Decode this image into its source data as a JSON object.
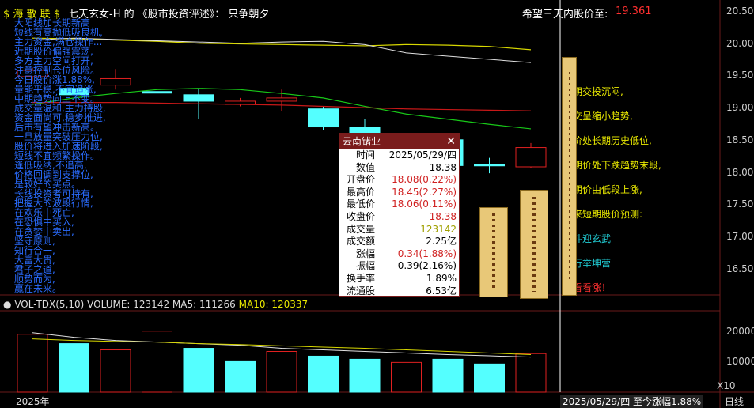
{
  "header": {
    "tag": "$ 海 散 联 $",
    "sep": "七天玄女-H  的 《股市投资评述》： 只争朝夕",
    "target_label": "希望三天内股价至:",
    "target_value": "19.361"
  },
  "axis_right": [
    "20.50",
    "20.00",
    "19.50",
    "19.00",
    "18.50",
    "18.00",
    "17.50",
    "17.00",
    "16.50"
  ],
  "vol_axis": [
    "20000",
    "10000"
  ],
  "vol_header": {
    "name": "VOL-TDX(5,10)",
    "volume": "VOLUME: 123142",
    "ma5": "MA5: 111266",
    "ma10": "MA10: 120337"
  },
  "footer": {
    "year": "2025年",
    "date_change": "2025/05/29/四  至今涨幅1.88%",
    "scale": "X10",
    "period": "日线"
  },
  "popup": {
    "title": "云南锗业",
    "rows": [
      {
        "label": "时间",
        "value": "2025/05/29/四",
        "color": "#000"
      },
      {
        "label": "数值",
        "value": "18.38",
        "color": "#000"
      },
      {
        "label": "开盘价",
        "value": "18.08(0.22%)",
        "color": "#d02020"
      },
      {
        "label": "最高价",
        "value": "18.45(2.27%)",
        "color": "#d02020"
      },
      {
        "label": "最低价",
        "value": "18.06(0.11%)",
        "color": "#d02020"
      },
      {
        "label": "收盘价",
        "value": "18.38",
        "color": "#d02020"
      },
      {
        "label": "成交量",
        "value": "123142",
        "color": "#a0a000"
      },
      {
        "label": "成交额",
        "value": "2.25亿",
        "color": "#000"
      },
      {
        "label": "涨幅",
        "value": "0.34(1.88%)",
        "color": "#d02020"
      },
      {
        "label": "振幅",
        "value": "0.39(2.16%)",
        "color": "#000"
      },
      {
        "label": "换手率",
        "value": "1.89%",
        "color": "#000"
      },
      {
        "label": "流通股",
        "value": "6.53亿",
        "color": "#000"
      }
    ]
  },
  "left_text": [
    "大阳线加长期新高",
    "短线有高抛低吸良机,",
    "主力资金,满仓操作...",
    "近期股价偏强震荡,",
    "多方主力空间打开,",
    "注意控制仓位风险。",
    "今日股价涨1.88%,",
    "量能平稳,不宜追涨,",
    "中期趋势向上不变。",
    "成交量温和,主力持股,",
    "资金面尚可,稳步推进,",
    "后市有望冲击新高。",
    "一旦放量突破压力位,",
    "股价将进入加速阶段,",
    "短线不宜频繁操作。",
    "逢低吸纳,不追高,",
    "价格回调到支撑位,",
    "是较好的买点。",
    "长线投资者可持有,",
    "把握大的波段行情,",
    "在欢乐中死亡,",
    "在恐惧中买入,",
    "在贪婪中卖出,",
    "坚守原则,",
    "知行合一,",
    "大富大贵,",
    "君子之道,",
    "顺势而为,",
    "赢在未来。"
  ],
  "right_text": [
    {
      "t": "近期交投沉闷,",
      "c": "#e8e800"
    },
    {
      "t": "成交呈缩小趋势,",
      "c": "#e8e800"
    },
    {
      "t": "现价处长期历史低位,",
      "c": "#e8e800"
    },
    {
      "t": "中期价处下跌趋势末段,",
      "c": "#e8e800"
    },
    {
      "t": "短期价由低段上涨,",
      "c": "#e8e800"
    },
    {
      "t": "未来短期股价预测:",
      "c": "#e8e800"
    },
    {
      "t": "北斗迎玄武",
      "c": "#20c8d0"
    },
    {
      "t": "五行举坤营",
      "c": "#20c8d0"
    },
    {
      "t": "要看看涨！",
      "c": "#ff3030"
    }
  ],
  "chart_data": {
    "type": "candlestick",
    "ylim": [
      16.2,
      20.6
    ],
    "candles": [
      {
        "o": 19.48,
        "c": 19.58,
        "h": 19.62,
        "l": 19.4,
        "up": true
      },
      {
        "o": 19.2,
        "c": 19.3,
        "h": 19.5,
        "l": 19.05,
        "up": false
      },
      {
        "o": 19.35,
        "c": 19.45,
        "h": 19.6,
        "l": 19.28,
        "up": true
      },
      {
        "o": 19.25,
        "c": 19.23,
        "h": 19.65,
        "l": 18.98,
        "up": false
      },
      {
        "o": 19.2,
        "c": 19.1,
        "h": 19.3,
        "l": 18.82,
        "up": false
      },
      {
        "o": 19.05,
        "c": 19.1,
        "h": 19.15,
        "l": 19.02,
        "up": true
      },
      {
        "o": 19.1,
        "c": 19.15,
        "h": 19.28,
        "l": 18.95,
        "up": true
      },
      {
        "o": 18.98,
        "c": 18.7,
        "h": 19.02,
        "l": 18.65,
        "up": false
      },
      {
        "o": 18.7,
        "c": 18.6,
        "h": 18.82,
        "l": 18.45,
        "up": false
      },
      {
        "o": 18.55,
        "c": 18.45,
        "h": 18.6,
        "l": 18.4,
        "up": false
      },
      {
        "o": 18.5,
        "c": 18.1,
        "h": 18.52,
        "l": 18.05,
        "up": false
      },
      {
        "o": 18.12,
        "c": 18.1,
        "h": 18.22,
        "l": 17.98,
        "up": false
      },
      {
        "o": 18.08,
        "c": 18.38,
        "h": 18.45,
        "l": 18.06,
        "up": true
      }
    ],
    "volumes": [
      {
        "v": 18500,
        "up": true
      },
      {
        "v": 15500,
        "up": false
      },
      {
        "v": 13500,
        "up": true
      },
      {
        "v": 19500,
        "up": true
      },
      {
        "v": 14000,
        "up": false
      },
      {
        "v": 10000,
        "up": false
      },
      {
        "v": 13000,
        "up": true
      },
      {
        "v": 11500,
        "up": false
      },
      {
        "v": 10500,
        "up": false
      },
      {
        "v": 9500,
        "up": true
      },
      {
        "v": 10500,
        "up": false
      },
      {
        "v": 9000,
        "up": false
      },
      {
        "v": 12314,
        "up": true
      }
    ],
    "vol_ylim": [
      0,
      26000
    ],
    "colors": {
      "up": "#e02020",
      "down": "#54ffff",
      "ma_yellow": "#d8d800",
      "ma_green": "#18c818",
      "ma_red": "#c81818",
      "ma_white": "#e0e0e0"
    }
  }
}
